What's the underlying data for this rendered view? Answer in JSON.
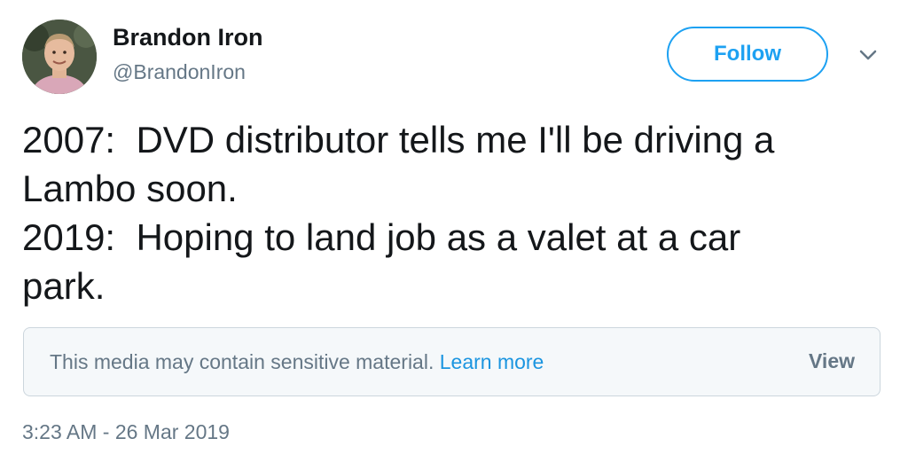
{
  "author": {
    "display_name": "Brandon Iron",
    "handle": "@BrandonIron"
  },
  "follow_button": {
    "label": "Follow"
  },
  "menu": {
    "icon": "chevron-down-icon"
  },
  "tweet": {
    "text": "2007:  DVD distributor tells me I'll be driving a\nLambo soon.\n2019:  Hoping to land job as a valet at a car\npark."
  },
  "sensitive_media": {
    "message": "This media may contain sensitive material.",
    "learn_more": "Learn more",
    "view": "View"
  },
  "timestamp": "3:23 AM - 26 Mar 2019",
  "colors": {
    "accent": "#1da1f2",
    "link": "#1b95e0",
    "secondary_text": "#657786",
    "primary_text": "#14171a"
  }
}
